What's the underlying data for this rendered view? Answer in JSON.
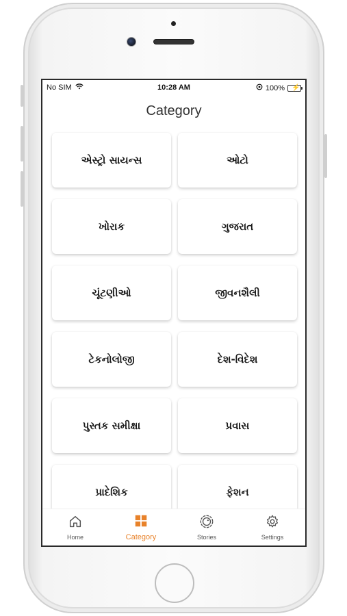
{
  "status_bar": {
    "carrier": "No SIM",
    "time": "10:28 AM",
    "battery": "100%"
  },
  "header": {
    "title": "Category"
  },
  "categories": [
    {
      "label": "એસ્ટ્રો સાયન્સ"
    },
    {
      "label": "ઓટો"
    },
    {
      "label": "ખોરાક"
    },
    {
      "label": "ગુજરાત"
    },
    {
      "label": "ચૂંટણીઓ"
    },
    {
      "label": "જીવનશૈલી"
    },
    {
      "label": "ટેકનોલોજી"
    },
    {
      "label": "દેશ-વિદેશ"
    },
    {
      "label": "પુસ્તક સમીક્ષા"
    },
    {
      "label": "પ્રવાસ"
    },
    {
      "label": "પ્રાદેશિક"
    },
    {
      "label": "ફેશન"
    }
  ],
  "tabs": [
    {
      "label": "Home",
      "icon": "home-icon"
    },
    {
      "label": "Category",
      "icon": "grid-icon",
      "active": true
    },
    {
      "label": "Stories",
      "icon": "stories-icon"
    },
    {
      "label": "Settings",
      "icon": "gear-icon"
    }
  ],
  "colors": {
    "accent": "#e8822a",
    "text": "#1a1a1a",
    "inactive": "#555555"
  }
}
